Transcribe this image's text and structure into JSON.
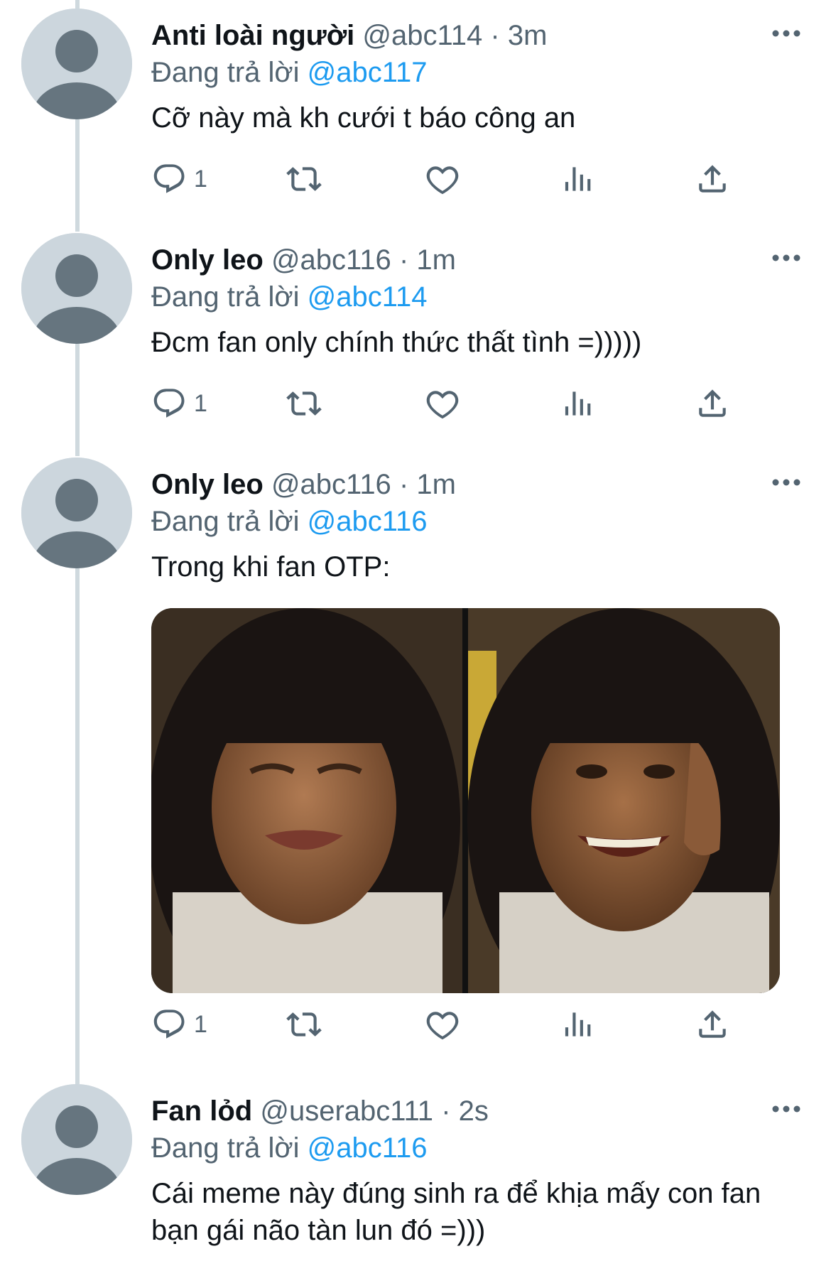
{
  "tweets": [
    {
      "name": "Anti loài người",
      "handle": "@abc114",
      "time": "3m",
      "replying_prefix": "Đang trả lời",
      "replying_to": "@abc117",
      "text": "Cỡ này mà kh cưới t báo công an",
      "reply_count": "1"
    },
    {
      "name": "Only leo",
      "handle": "@abc116",
      "time": "1m",
      "replying_prefix": "Đang trả lời",
      "replying_to": "@abc114",
      "text": "Đcm fan only chính thức thất tình =)))))",
      "reply_count": "1"
    },
    {
      "name": "Only leo",
      "handle": "@abc116",
      "time": "1m",
      "replying_prefix": "Đang trả lời",
      "replying_to": "@abc116",
      "text": "Trong khi fan OTP:",
      "reply_count": "1",
      "media": "crying-then-laughing-girl-meme"
    },
    {
      "name": "Fan lỏd",
      "handle": "@userabc111",
      "time": "2s",
      "replying_prefix": "Đang trả lời",
      "replying_to": "@abc116",
      "text": "Cái meme này đúng sinh ra để khịa mấy con fan bạn gái não tàn lun đó =)))"
    }
  ],
  "icons": [
    "reply-icon",
    "retweet-icon",
    "like-icon",
    "analytics-icon",
    "share-icon",
    "more-icon"
  ],
  "colors": {
    "link": "#1d9bf0",
    "secondary": "#536471",
    "thread_line": "#cfd9de",
    "avatar_bg": "#ccd6dd",
    "avatar_fg": "#66757f"
  }
}
